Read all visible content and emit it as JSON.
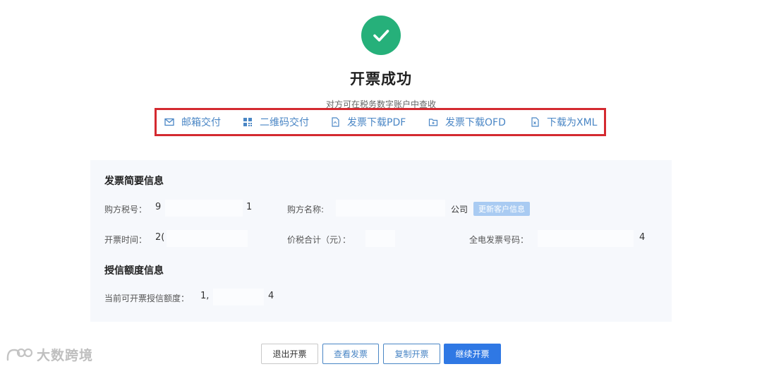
{
  "header": {
    "title": "开票成功",
    "subtitle": "对方可在税务数字账户中查收",
    "status_color": "#26b07a"
  },
  "delivery": {
    "highlight_color": "#d42a30",
    "options": [
      {
        "label": "邮箱交付",
        "icon": "mail-icon"
      },
      {
        "label": "二维码交付",
        "icon": "qrcode-icon"
      },
      {
        "label": "发票下载PDF",
        "icon": "pdf-file-icon"
      },
      {
        "label": "发票下载OFD",
        "icon": "ofd-file-icon"
      },
      {
        "label": "下载为XML",
        "icon": "xml-file-icon"
      }
    ]
  },
  "summary": {
    "title": "发票简要信息",
    "buyer_tax_id": {
      "label": "购方税号：",
      "value_start": "9",
      "value_end": "1"
    },
    "buyer_name": {
      "label": "购方名称:",
      "value_end": "公司"
    },
    "update_button": "更新客户信息",
    "issue_time": {
      "label": "开票时间：",
      "value_start": "2("
    },
    "total_with_tax": {
      "label": "价税合计（元）："
    },
    "invoice_number": {
      "label": "全电发票号码：",
      "value_end": "4"
    }
  },
  "credit": {
    "title": "授信额度信息",
    "current_limit": {
      "label": "当前可开票授信额度：",
      "value_start": "1,",
      "value_end": "4"
    }
  },
  "actions": {
    "exit": "退出开票",
    "view": "查看发票",
    "copy": "复制开票",
    "continue": "继续开票",
    "primary_color": "#2f78e4"
  },
  "watermark": {
    "text": "大数跨境"
  }
}
